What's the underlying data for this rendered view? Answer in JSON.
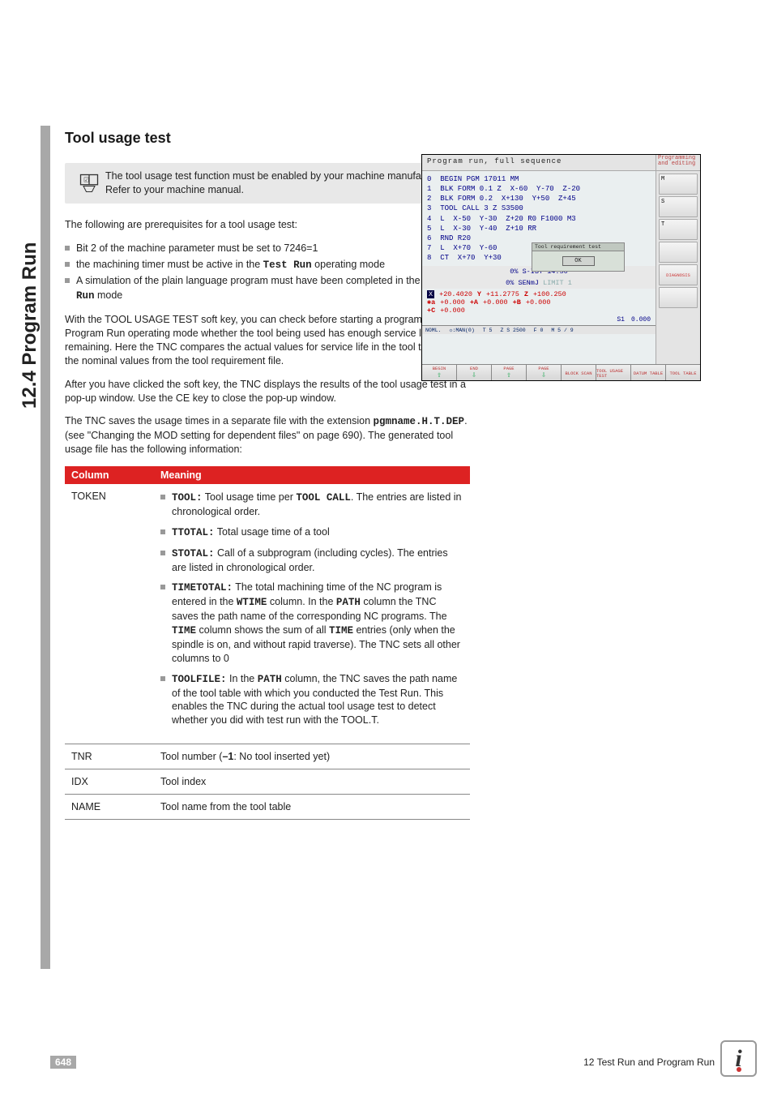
{
  "side_title": "12.4 Program Run",
  "heading": "Tool usage test",
  "note": "The tool usage test function must be enabled by your machine manufacturer. Refer to your machine manual.",
  "intro": "The following are prerequisites for a tool usage test:",
  "prereqs": [
    "Bit 2 of the machine parameter must be set to 7246=1",
    "the machining timer must be active in the Test Run operating mode",
    "A simulation of the plain language program must have been completed in the Test Run mode"
  ],
  "testrun_label": "Test Run",
  "para1": "With the TOOL USAGE TEST soft key, you can check before starting a program in a Program Run operating mode whether the tool being used has enough service life remaining. Here the TNC compares the actual values for service life in the tool table with the nominal values from the tool requirement file.",
  "para2": "After you have clicked the soft key, the TNC displays the results of the tool usage test in a pop-up window. Use the CE key to close the pop-up window.",
  "para3_pre": "The TNC saves the usage times in a separate file with the extension ",
  "para3_ext": "pgmname.H.T.DEP",
  "para3_post": ". (see \"Changing the MOD setting for dependent files\" on page 690). The generated tool usage file has the following information:",
  "table_headers": {
    "col": "Column",
    "meaning": "Meaning"
  },
  "rows": {
    "token": {
      "name": "TOKEN",
      "items": [
        {
          "b": "TOOL:",
          "t": " Tool usage time per ",
          "b2": "TOOL CALL",
          "t2": ". The entries are listed in chronological order."
        },
        {
          "b": "TTOTAL:",
          "t": " Total usage time of a tool"
        },
        {
          "b": "STOTAL:",
          "t": " Call of a subprogram (including cycles). The entries are listed in chronological order."
        },
        {
          "b": "TIMETOTAL:",
          "t": " The total machining time of the NC program is entered in the ",
          "b2": "WTIME",
          "t2": " column. In the ",
          "b3": "PATH",
          "t3": " column the TNC saves the path name of the corresponding NC programs. The ",
          "b4": "TIME",
          "t4": " column shows the sum of all ",
          "b5": "TIME",
          "t5": " entries (only when the spindle is on, and without rapid traverse). The TNC sets all other columns to 0"
        },
        {
          "b": "TOOLFILE:",
          "t": " In the ",
          "b2": "PATH",
          "t2": " column, the TNC saves the path name of the tool table with which you conducted the Test Run. This enables the TNC during the actual tool usage test to detect whether you did with test run with the TOOL.T."
        }
      ]
    },
    "tnr": {
      "name": "TNR",
      "text_pre": "Tool number (",
      "bold": "–1",
      "text_post": ": No tool inserted yet)"
    },
    "idx": {
      "name": "IDX",
      "text": "Tool index"
    },
    "nameRow": {
      "name": "NAME",
      "text": "Tool name from the tool table"
    }
  },
  "shot": {
    "title": "Program run, full sequence",
    "side_head": "Programming and editing",
    "code": [
      "0  BEGIN PGM 17011 MM",
      "1  BLK FORM 0.1 Z  X-60  Y-70  Z-20",
      "2  BLK FORM 0.2  X+130  Y+50  Z+45",
      "3  TOOL CALL 3 Z S3500",
      "4  L  X-50  Y-30  Z+20 R0 F1000 M3",
      "5  L  X-30  Y-40  Z+10 RR",
      "6  RND R20",
      "7  L  X+70  Y-60",
      "8  CT  X+70  Y+30"
    ],
    "dialog_title": "Tool requirement test",
    "dialog_ok": "OK",
    "status1": "0% S-IST 14:50",
    "status2_a": "0% SENmJ ",
    "status2_b": "LIMIT 1",
    "coords": {
      "x": "+20.4020",
      "y": "+11.2775",
      "z": "+100.250",
      "a": "+0.000",
      "aA": "+A",
      "b": "+0.000",
      "bB": "+B",
      "c2": "+0.000",
      "cC": "+C",
      "cVal": "+0.000"
    },
    "spindle": {
      "s1": "S1",
      "sval": "0.000"
    },
    "bottom": {
      "noml": "NOML.",
      "man": "☼:MAN(0)",
      "t": "T 5",
      "z": "Z S 2500",
      "f": "F 0",
      "m": "M 5 / 9"
    },
    "softkeys": [
      "BEGIN",
      "END",
      "PAGE",
      "PAGE",
      "BLOCK SCAN",
      "TOOL USAGE TEST",
      "DATUM TABLE",
      "TOOL TABLE"
    ],
    "rightbtns": [
      "M",
      "S",
      "T",
      "",
      "DIAGNOSIS",
      ""
    ]
  },
  "footer": {
    "page": "648",
    "chapter": "12 Test Run and Program Run"
  }
}
